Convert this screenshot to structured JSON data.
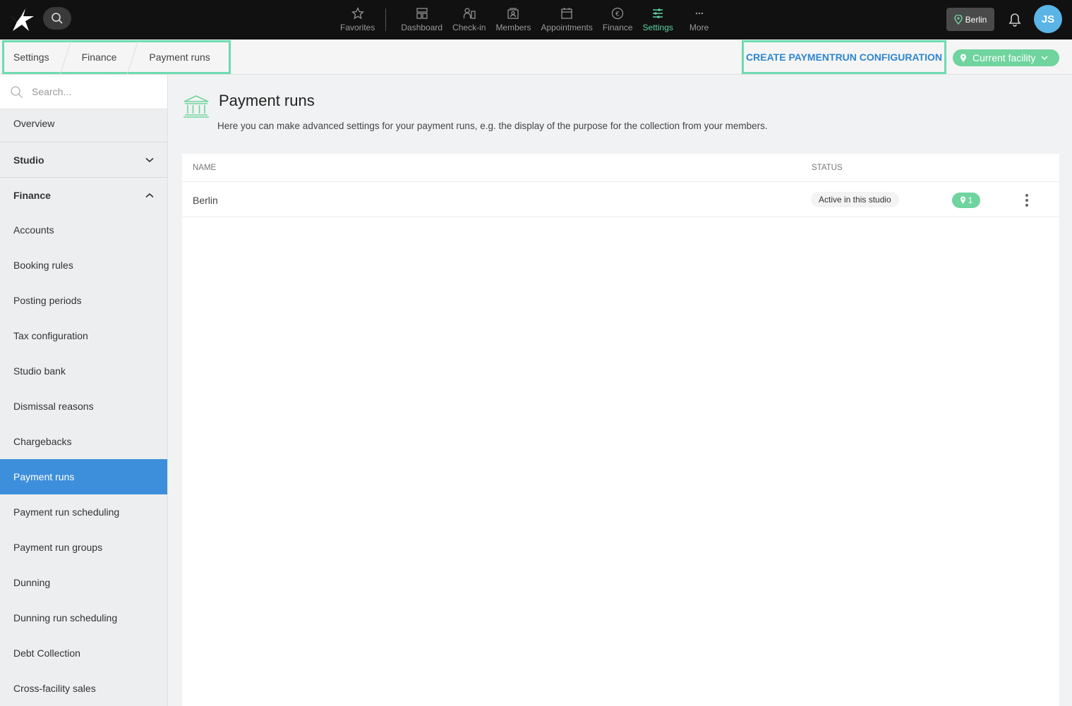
{
  "topnav": {
    "items": [
      {
        "label": "Favorites",
        "icon": "star-icon"
      },
      {
        "label": "Dashboard",
        "icon": "dashboard-icon"
      },
      {
        "label": "Check-in",
        "icon": "checkin-icon"
      },
      {
        "label": "Members",
        "icon": "members-icon"
      },
      {
        "label": "Appointments",
        "icon": "calendar-icon"
      },
      {
        "label": "Finance",
        "icon": "euro-icon"
      },
      {
        "label": "Settings",
        "icon": "sliders-icon"
      },
      {
        "label": "More",
        "icon": "more-icon"
      }
    ],
    "active": "Settings",
    "location": "Berlin",
    "avatar_initials": "JS"
  },
  "breadcrumb": [
    "Settings",
    "Finance",
    "Payment runs"
  ],
  "actions": {
    "create_label": "CREATE PAYMENTRUN CONFIGURATION",
    "facility_label": "Current facility"
  },
  "sidebar": {
    "search_placeholder": "Search...",
    "overview": "Overview",
    "studio": "Studio",
    "finance": "Finance",
    "items": [
      "Accounts",
      "Booking rules",
      "Posting periods",
      "Tax configuration",
      "Studio bank",
      "Dismissal reasons",
      "Chargebacks",
      "Payment runs",
      "Payment run scheduling",
      "Payment run groups",
      "Dunning",
      "Dunning run scheduling",
      "Debt Collection",
      "Cross-facility sales"
    ],
    "active": "Payment runs"
  },
  "page": {
    "title": "Payment runs",
    "description": "Here you can make advanced settings for your payment runs, e.g. the display of the purpose for the collection from your members."
  },
  "table": {
    "headers": {
      "name": "NAME",
      "status": "STATUS"
    },
    "rows": [
      {
        "name": "Berlin",
        "status": "Active in this studio",
        "locations": "1"
      }
    ]
  },
  "colors": {
    "accent_green": "#6fd49e",
    "active_blue": "#3d8fdb",
    "link_blue": "#2e86d1",
    "highlight_border": "#6ddbb0"
  }
}
